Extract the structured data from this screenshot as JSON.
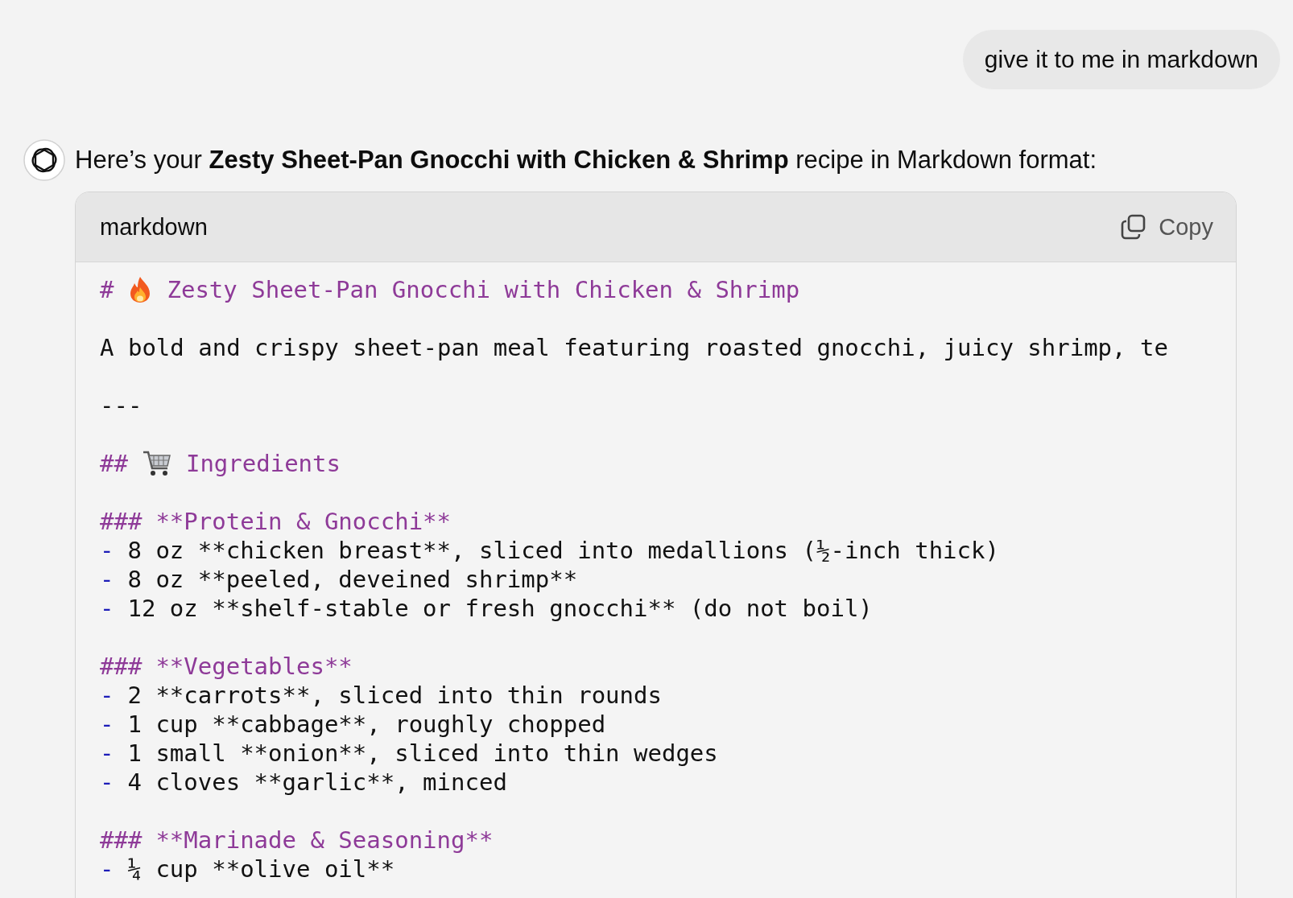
{
  "user_message": {
    "text": "give it to me in markdown"
  },
  "reply": {
    "intro": "Here’s your **Zesty Sheet-Pan Gnocchi with Chicken & Shrimp** recipe in Markdown format:",
    "code_block": {
      "language": "markdown",
      "copy_label": "Copy",
      "lines": [
        {
          "kind": "title",
          "marker": "#",
          "text": "Zesty Sheet-Pan Gnocchi with Chicken & Shrimp"
        },
        {
          "kind": "blank"
        },
        {
          "kind": "text",
          "text": "A bold and crispy sheet-pan meal featuring roasted gnocchi, juicy shrimp, te"
        },
        {
          "kind": "blank"
        },
        {
          "kind": "text",
          "text": "---"
        },
        {
          "kind": "blank"
        },
        {
          "kind": "section",
          "marker": "##",
          "text": "Ingredients"
        },
        {
          "kind": "blank"
        },
        {
          "kind": "subsection",
          "marker": "###",
          "text": "**Protein & Gnocchi**"
        },
        {
          "kind": "bullet",
          "marker": "-",
          "text": "8 oz **chicken breast**, sliced into medallions (½-inch thick)"
        },
        {
          "kind": "bullet",
          "marker": "-",
          "text": "8 oz **peeled, deveined shrimp**"
        },
        {
          "kind": "bullet",
          "marker": "-",
          "text": "12 oz **shelf-stable or fresh gnocchi** (do not boil)"
        },
        {
          "kind": "blank"
        },
        {
          "kind": "subsection",
          "marker": "###",
          "text": "**Vegetables**"
        },
        {
          "kind": "bullet",
          "marker": "-",
          "text": "2 **carrots**, sliced into thin rounds"
        },
        {
          "kind": "bullet",
          "marker": "-",
          "text": "1 cup **cabbage**, roughly chopped"
        },
        {
          "kind": "bullet",
          "marker": "-",
          "text": "1 small **onion**, sliced into thin wedges"
        },
        {
          "kind": "bullet",
          "marker": "-",
          "text": "4 cloves **garlic**, minced"
        },
        {
          "kind": "blank"
        },
        {
          "kind": "subsection",
          "marker": "###",
          "text": "**Marinade & Seasoning**"
        },
        {
          "kind": "bullet",
          "marker": "-",
          "text": "¼ cup **olive oil**"
        }
      ]
    }
  }
}
